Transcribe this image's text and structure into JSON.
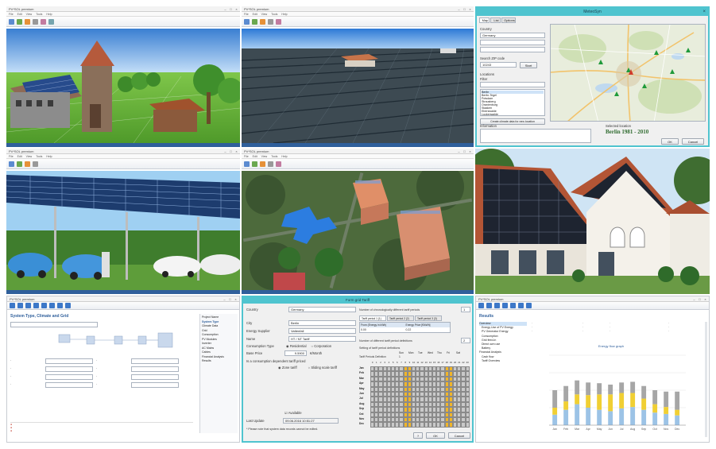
{
  "meteo": {
    "title": "MeteoSyn",
    "tabs": [
      "Map",
      "List",
      "Options"
    ],
    "country_label": "Country",
    "country_value": "Germany",
    "zip_label": "Search ZIP code",
    "zip_value": "10243",
    "start_label": "Start",
    "locations_label": "Locations",
    "filter_label": "Filter",
    "locations": [
      "Berlin",
      "Berlin-Tegel",
      "Potsdam",
      "Strausberg",
      "Oranienburg",
      "Staaken",
      "Eberswalde",
      "Luckenwalde"
    ],
    "create_label": "Create climate data for new location",
    "info_label": "Information",
    "selected_label": "Selected location",
    "selected_value": "Berlin 1981 - 2010",
    "ok": "OK",
    "cancel": "Cancel",
    "close": "×"
  },
  "tariff": {
    "title": "Form grid Tariff",
    "country_label": "Country",
    "country_value": "Germany",
    "city_label": "City",
    "city_value": "Berlin",
    "supplier_label": "Energy Supplier",
    "supplier_value": "Vattenfall",
    "name_label": "Name",
    "name_value": "HT / NT Tariff",
    "consumption_label": "Consumption Type",
    "residential": "Residential",
    "corporation": "Corporation",
    "base_price_label": "Base Price",
    "base_price_value": "9.5900",
    "base_price_unit": "€/Month",
    "cons_dep_label": "Is a consumption dependent tariff priced",
    "zone_tariff": "Zone tariff",
    "sliding_tariff": "Sliding scale tariff",
    "available_label": "Available",
    "last_update_label": "Last Update",
    "last_update_value": "09.06.2016 10:51:27",
    "required_note": "* Please note that system data records cannot be edited.",
    "periods_label": "Number of chronologically different tariff periods",
    "periods_value": "1",
    "period_tabs": [
      "Tariff period 1 (1)",
      "Tariff period 2 (2)",
      "Tariff period 3 (3)"
    ],
    "col_from": "From (Energy in kWh)",
    "col_price": "Energy Price [€/kWh]",
    "row_from": "0.00",
    "row_price": "0.22",
    "different_periods_label": "Number of different tariff period definitions",
    "different_periods_value": "2",
    "setting_label": "Setting of tariff period definitions",
    "days": [
      "Sun",
      "Mon",
      "Tue",
      "Wed",
      "Thu",
      "Fri",
      "Sat"
    ],
    "tariff_def_label": "Tariff Periods Definition",
    "tariff_def_value": "1",
    "months": [
      "Jan",
      "Feb",
      "Mar",
      "Apr",
      "May",
      "Jun",
      "Jul",
      "Aug",
      "Sep",
      "Oct",
      "Nov",
      "Dec"
    ],
    "hours": [
      "0",
      "1",
      "2",
      "3",
      "4",
      "5",
      "6",
      "7",
      "8",
      "9",
      "10",
      "11",
      "12",
      "13",
      "14",
      "15",
      "16",
      "17",
      "18",
      "19",
      "20",
      "21",
      "22",
      "23"
    ],
    "ok": "OK",
    "cancel": "Cancel"
  },
  "project": {
    "title": "System Type, Climate and Grid",
    "sidebar_items": [
      "Project Name",
      "System Type",
      "Climate Data",
      "Grid",
      "Consumption",
      "PV Modules",
      "Inverter",
      "AC Mains",
      "Cables",
      "Financial Analysis",
      "Results"
    ],
    "save_label": "OK"
  },
  "results": {
    "title": "Results",
    "chart_title": "Energy flow graph",
    "tree": [
      "Overview",
      "Energy Use of PV Energy",
      "PV Generator Energy",
      "Consumption",
      "Grid feed-in",
      "Direct own use",
      "Battery",
      "Financial Analysis",
      "Cash flow",
      "Tariff Overview"
    ]
  },
  "colors": {
    "window_blue": "#2f5f9b",
    "dialog_teal": "#4fc4cf",
    "bar_blue": "#9cc3e6",
    "bar_yellow": "#f0cf33",
    "bar_gray": "#a6a6a6"
  },
  "chart_data": {
    "type": "bar",
    "title": "",
    "categories": [
      "Jan",
      "Feb",
      "Mar",
      "Apr",
      "May",
      "Jun",
      "Jul",
      "Aug",
      "Sep",
      "Oct",
      "Nov",
      "Dec"
    ],
    "series": [
      {
        "name": "",
        "values": [
          15,
          22,
          30,
          25,
          22,
          20,
          24,
          26,
          22,
          18,
          16,
          14
        ]
      },
      {
        "name": "",
        "values": [
          10,
          12,
          14,
          18,
          22,
          24,
          22,
          20,
          16,
          12,
          10,
          8
        ]
      },
      {
        "name": "",
        "values": [
          25,
          22,
          20,
          18,
          16,
          14,
          15,
          16,
          18,
          20,
          22,
          26
        ]
      }
    ],
    "ylim": [
      0,
      100
    ],
    "grid": true
  }
}
